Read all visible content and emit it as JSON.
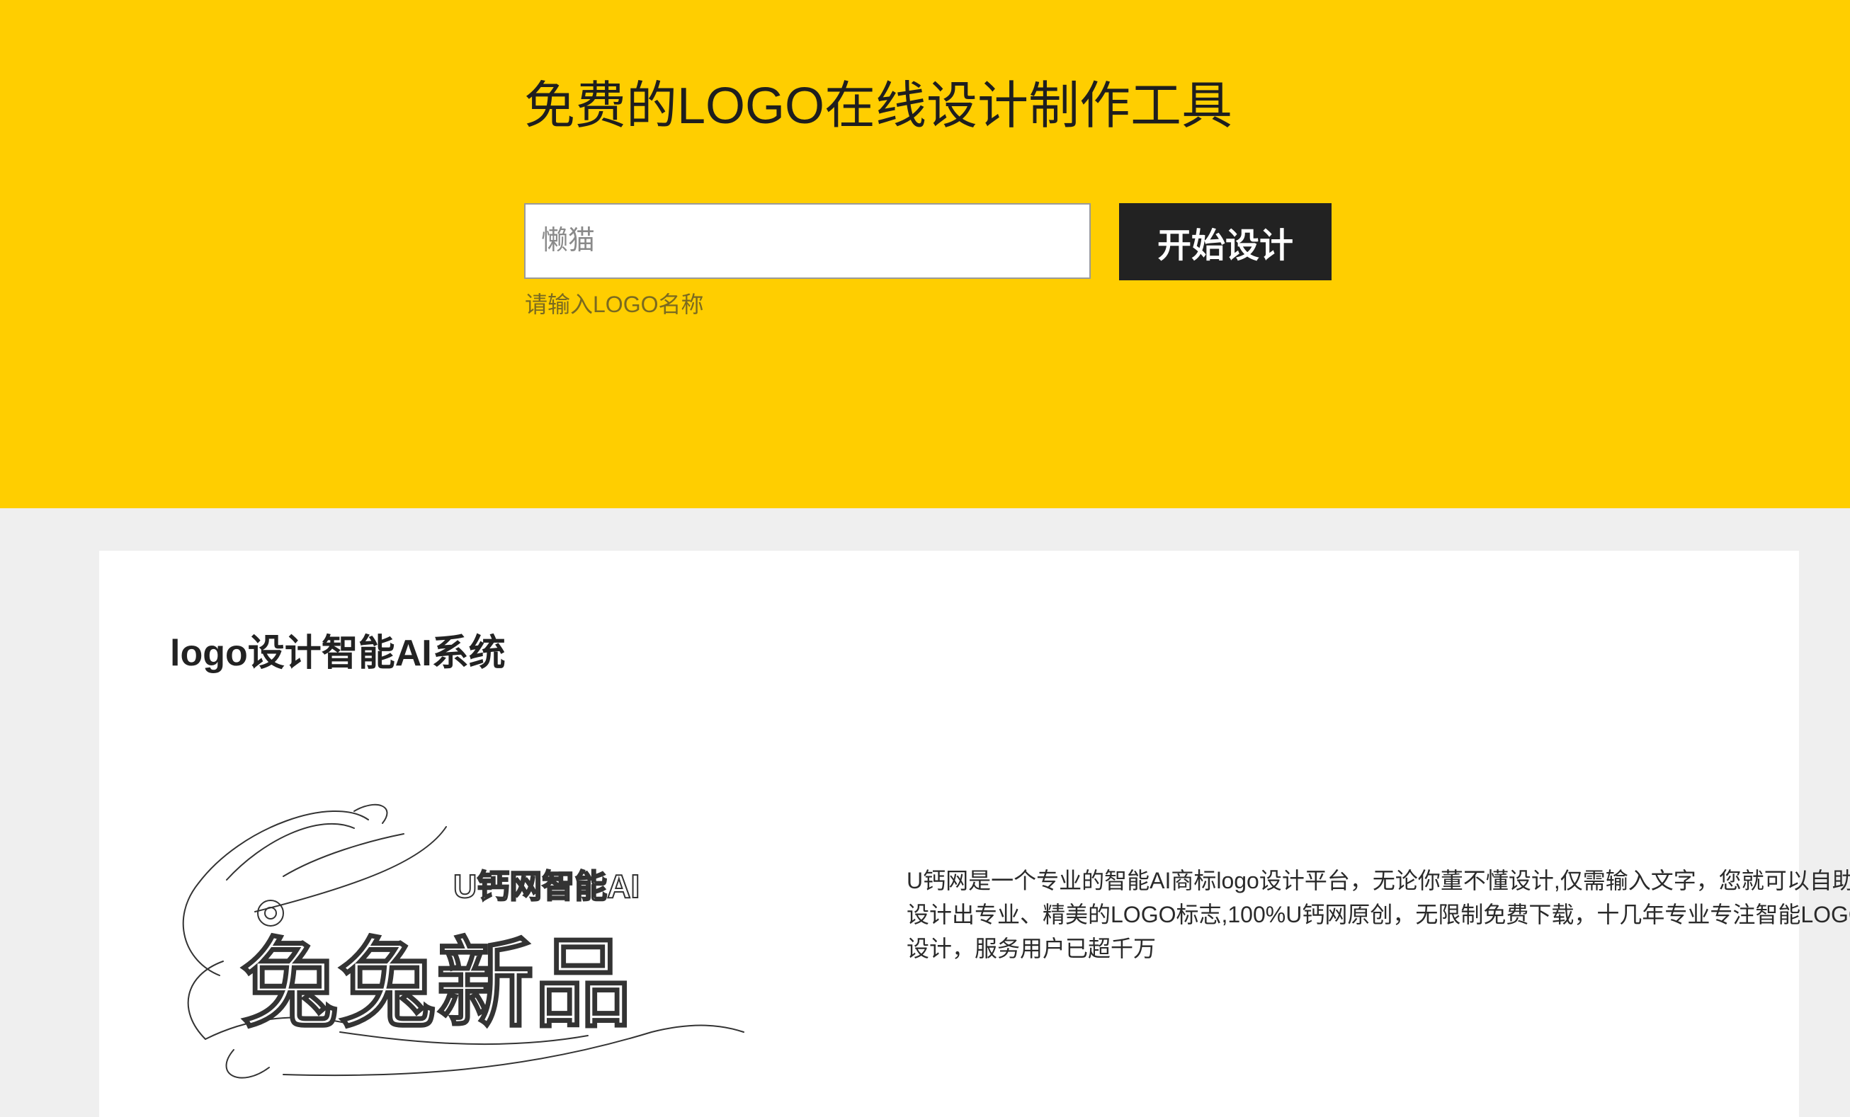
{
  "hero": {
    "title": "免费的LOGO在线设计制作工具",
    "input_placeholder": "懒猫",
    "input_value": "",
    "start_button_label": "开始设计",
    "input_hint": "请输入LOGO名称"
  },
  "intro": {
    "section_title": "logo设计智能AI系统",
    "logo_example": {
      "tagline": "U钙网智能AI",
      "name": "兔兔新品"
    },
    "description": "U钙网是一个专业的智能AI商标logo设计平台，无论你董不懂设计,仅需输入文字，您就可以自助设计出专业、精美的LOGO标志,100%U钙网原创，无限制免费下载，十几年专业专注智能LOGO设计，服务用户已超千万"
  },
  "colors": {
    "hero_background": "#ffce00",
    "page_background": "#efefef",
    "button_background": "#222222",
    "button_text": "#ffffff"
  }
}
